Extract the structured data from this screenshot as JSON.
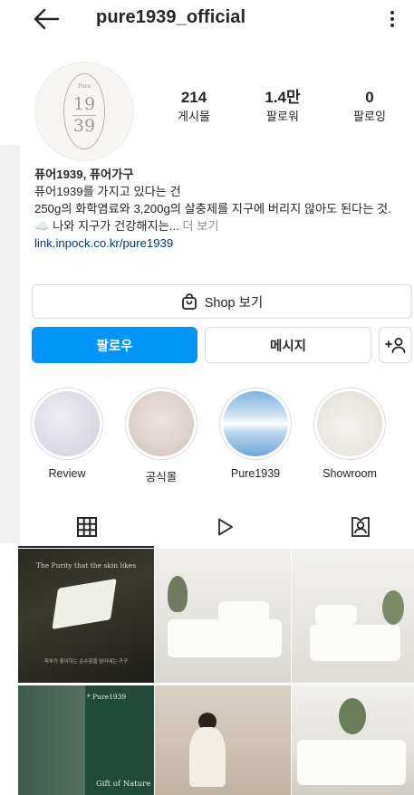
{
  "header": {
    "username": "pure1939_official"
  },
  "avatar": {
    "logo_small": "Pure",
    "logo_line1": "19",
    "logo_line2": "39"
  },
  "stats": {
    "posts": {
      "value": "214",
      "label": "게시물"
    },
    "followers": {
      "value": "1.4만",
      "label": "팔로워"
    },
    "following": {
      "value": "0",
      "label": "팔로잉"
    }
  },
  "bio": {
    "name": "퓨어1939, 퓨어가구",
    "line1": "퓨어1939를 가지고 있다는 건",
    "line2": "250g의 화학염료와 3,200g의 살충제를 지구에 버리지 않아도 된다는 것.",
    "line3": "☁️ 나와 지구가 건강해지는...",
    "more": " 더 보기",
    "link": "link.inpock.co.kr/pure1939"
  },
  "buttons": {
    "shop": "Shop 보기",
    "follow": "팔로우",
    "message": "메시지"
  },
  "highlights": [
    {
      "label": "Review"
    },
    {
      "label": "공식몰"
    },
    {
      "label": "Pure1939"
    },
    {
      "label": "Showroom"
    }
  ],
  "posts": {
    "p1_title": "The Purity that the skin likes",
    "p1_foot": "피부가 좋아하는 순수함을 담아내는 가구",
    "p4_title": "* Pure1939",
    "p4_foot": "Gift of Nature"
  },
  "colors": {
    "primary": "#0095f6",
    "text": "#262626",
    "link": "#00376b",
    "muted": "#8e8e8e",
    "border": "#dbdbdb"
  }
}
